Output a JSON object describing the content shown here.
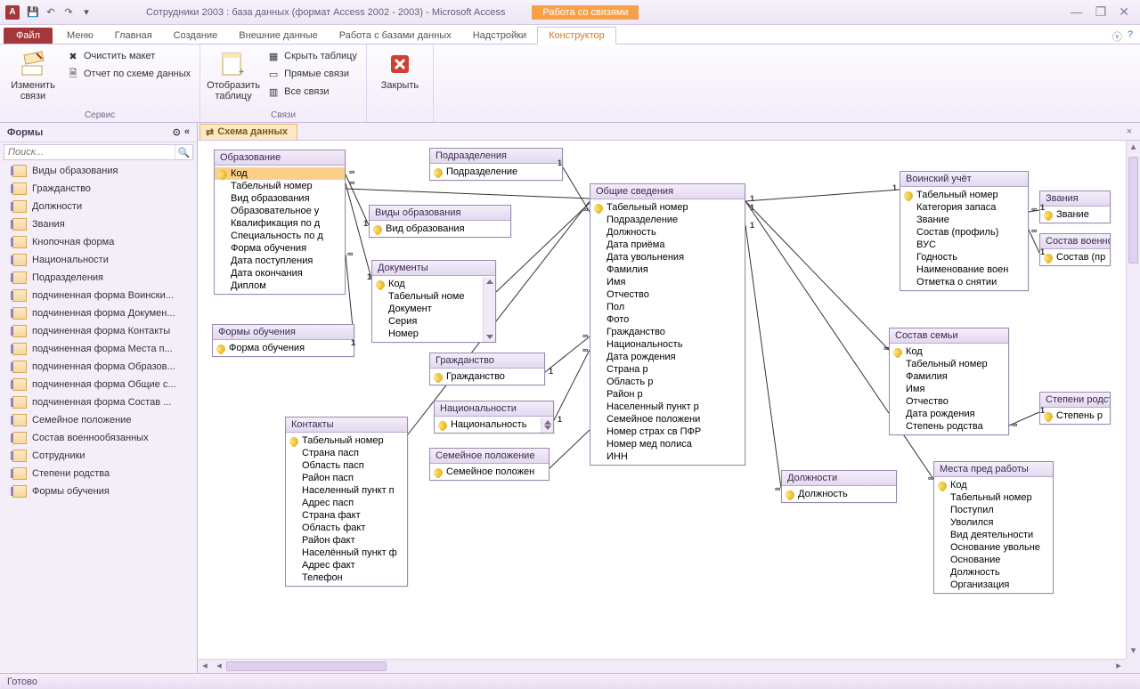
{
  "title": "Сотрудники 2003 : база данных (формат Access 2002 - 2003)  -  Microsoft Access",
  "context_tab": "Работа со связями",
  "tabs": {
    "file": "Файл",
    "menu": "Меню",
    "home": "Главная",
    "create": "Создание",
    "external": "Внешние данные",
    "dbtools": "Работа с базами данных",
    "addins": "Надстройки",
    "design": "Конструктор"
  },
  "ribbon": {
    "g1": {
      "edit": "Изменить связи",
      "clear": "Очистить макет",
      "report": "Отчет по схеме данных",
      "label": "Сервис"
    },
    "g2": {
      "show": "Отобразить таблицу",
      "hide": "Скрыть таблицу",
      "direct": "Прямые связи",
      "all": "Все связи",
      "label": "Связи"
    },
    "g3": {
      "close": "Закрыть"
    }
  },
  "nav": {
    "header": "Формы",
    "search": "Поиск...",
    "items": [
      "Виды образования",
      "Гражданство",
      "Должности",
      "Звания",
      "Кнопочная форма",
      "Национальности",
      "Подразделения",
      "подчиненная форма Воински...",
      "подчиненная форма Докумен...",
      "подчиненная форма Контакты",
      "подчиненная форма Места п...",
      "подчиненная форма Образов...",
      "подчиненная форма Общие с...",
      "подчиненная форма Состав ...",
      "Семейное положение",
      "Состав военнообязанных",
      "Сотрудники",
      "Степени родства",
      "Формы обучения"
    ]
  },
  "doc_tab": "Схема данных",
  "status": "Готово",
  "tables": {
    "obraz": {
      "title": "Образование",
      "fields": [
        {
          "n": "Код",
          "k": true,
          "sel": true
        },
        {
          "n": "Табельный номер"
        },
        {
          "n": "Вид образования"
        },
        {
          "n": "Образовательное у"
        },
        {
          "n": "Квалификация по д"
        },
        {
          "n": "Специальность по д"
        },
        {
          "n": "Форма обучения"
        },
        {
          "n": "Дата поступления"
        },
        {
          "n": "Дата окончания"
        },
        {
          "n": "Диплом"
        }
      ]
    },
    "podraz": {
      "title": "Подразделения",
      "fields": [
        {
          "n": "Подразделение",
          "k": true
        }
      ]
    },
    "vidy": {
      "title": "Виды образования",
      "fields": [
        {
          "n": "Вид образования",
          "k": true
        }
      ]
    },
    "docs": {
      "title": "Документы",
      "fields": [
        {
          "n": "Код",
          "k": true
        },
        {
          "n": "Табельный номе"
        },
        {
          "n": "Документ"
        },
        {
          "n": "Серия"
        },
        {
          "n": "Номер"
        }
      ],
      "scroll": true
    },
    "formy": {
      "title": "Формы обучения",
      "fields": [
        {
          "n": "Форма обучения",
          "k": true
        }
      ]
    },
    "grazh": {
      "title": "Гражданство",
      "fields": [
        {
          "n": "Гражданство",
          "k": true
        }
      ]
    },
    "natz": {
      "title": "Национальности",
      "fields": [
        {
          "n": "Национальность",
          "k": true
        }
      ],
      "scroll": true
    },
    "sem": {
      "title": "Семейное положение",
      "fields": [
        {
          "n": "Семейное положен",
          "k": true
        }
      ]
    },
    "kont": {
      "title": "Контакты",
      "fields": [
        {
          "n": "Табельный номер",
          "k": true
        },
        {
          "n": "Страна пасп"
        },
        {
          "n": "Область пасп"
        },
        {
          "n": "Район пасп"
        },
        {
          "n": "Населенный пункт п"
        },
        {
          "n": "Адрес пасп"
        },
        {
          "n": "Страна факт"
        },
        {
          "n": "Область факт"
        },
        {
          "n": "Район факт"
        },
        {
          "n": "Населённый пункт ф"
        },
        {
          "n": "Адрес факт"
        },
        {
          "n": "Телефон"
        }
      ]
    },
    "obsh": {
      "title": "Общие сведения",
      "fields": [
        {
          "n": "Табельный номер",
          "k": true
        },
        {
          "n": "Подразделение"
        },
        {
          "n": "Должность"
        },
        {
          "n": "Дата приёма"
        },
        {
          "n": "Дата увольнения"
        },
        {
          "n": "Фамилия"
        },
        {
          "n": "Имя"
        },
        {
          "n": "Отчество"
        },
        {
          "n": "Пол"
        },
        {
          "n": "Фото"
        },
        {
          "n": "Гражданство"
        },
        {
          "n": "Национальность"
        },
        {
          "n": "Дата рождения"
        },
        {
          "n": "Страна р"
        },
        {
          "n": "Область р"
        },
        {
          "n": "Район р"
        },
        {
          "n": "Населенный пункт р"
        },
        {
          "n": "Семейное положени"
        },
        {
          "n": "Номер страх св ПФР"
        },
        {
          "n": "Номер мед полиса"
        },
        {
          "n": "ИНН"
        }
      ]
    },
    "dolzh": {
      "title": "Должности",
      "fields": [
        {
          "n": "Должность",
          "k": true
        }
      ]
    },
    "voin": {
      "title": "Воинский учёт",
      "fields": [
        {
          "n": "Табельный номер",
          "k": true
        },
        {
          "n": "Категория запаса"
        },
        {
          "n": "Звание"
        },
        {
          "n": "Состав (профиль)"
        },
        {
          "n": "ВУС"
        },
        {
          "n": "Годность"
        },
        {
          "n": "Наименование воен"
        },
        {
          "n": "Отметка о снятии"
        }
      ]
    },
    "zvan": {
      "title": "Звания",
      "fields": [
        {
          "n": "Звание",
          "k": true
        }
      ]
    },
    "sostvo": {
      "title": "Состав военно",
      "fields": [
        {
          "n": "Состав (пр",
          "k": true
        }
      ]
    },
    "sostav": {
      "title": "Состав семьи",
      "fields": [
        {
          "n": "Код",
          "k": true
        },
        {
          "n": "Табельный номер"
        },
        {
          "n": "Фамилия"
        },
        {
          "n": "Имя"
        },
        {
          "n": "Отчество"
        },
        {
          "n": "Дата рождения"
        },
        {
          "n": "Степень родства"
        }
      ]
    },
    "step": {
      "title": "Степени родст",
      "fields": [
        {
          "n": "Степень р",
          "k": true
        }
      ]
    },
    "mesta": {
      "title": "Места пред работы",
      "fields": [
        {
          "n": "Код",
          "k": true
        },
        {
          "n": "Табельный номер"
        },
        {
          "n": "Поступил"
        },
        {
          "n": "Уволился"
        },
        {
          "n": "Вид деятельности"
        },
        {
          "n": "Основание увольне"
        },
        {
          "n": "Основание"
        },
        {
          "n": "Должность"
        },
        {
          "n": "Организация"
        }
      ]
    }
  }
}
